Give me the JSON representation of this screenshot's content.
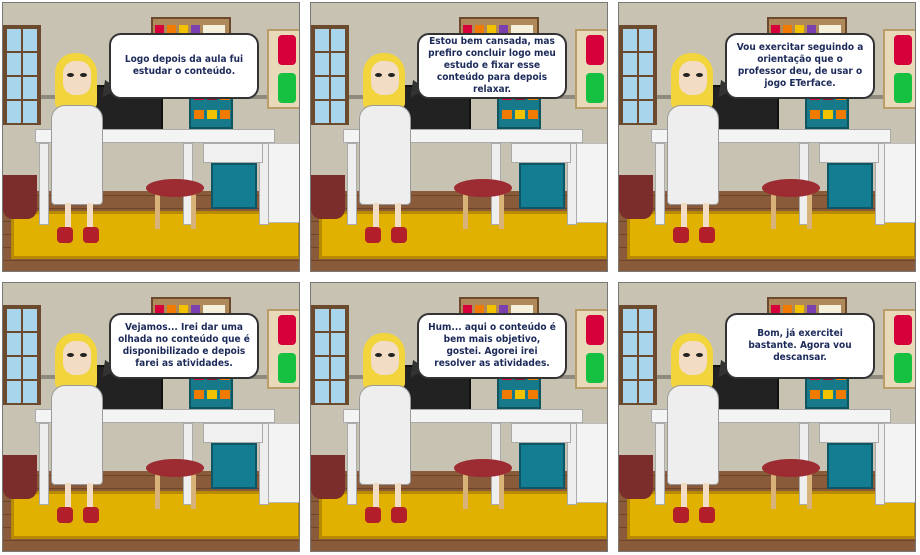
{
  "panels": [
    {
      "text": "Logo depois da aula fui estudar o conteúdo."
    },
    {
      "text": "Estou bem cansada, mas prefiro concluir logo meu estudo e fixar esse conteúdo para depois relaxar."
    },
    {
      "text": "Vou exercitar seguindo a orientação que o professor deu, de usar o jogo ETerface."
    },
    {
      "text": "Vejamos... Irei dar uma olhada no conteúdo que é disponibilizado e depois farei as atividades."
    },
    {
      "text": "Hum... aqui o conteúdo é bem mais objetivo, gostei. Agorei irei resolver as atividades."
    },
    {
      "text": "Bom, já exercitei bastante. Agora vou descansar."
    }
  ],
  "colors": {
    "wall": "#c8c2b3",
    "rug": "#e0b100",
    "teal": "#157d92",
    "speech_text": "#1c2a5a"
  }
}
